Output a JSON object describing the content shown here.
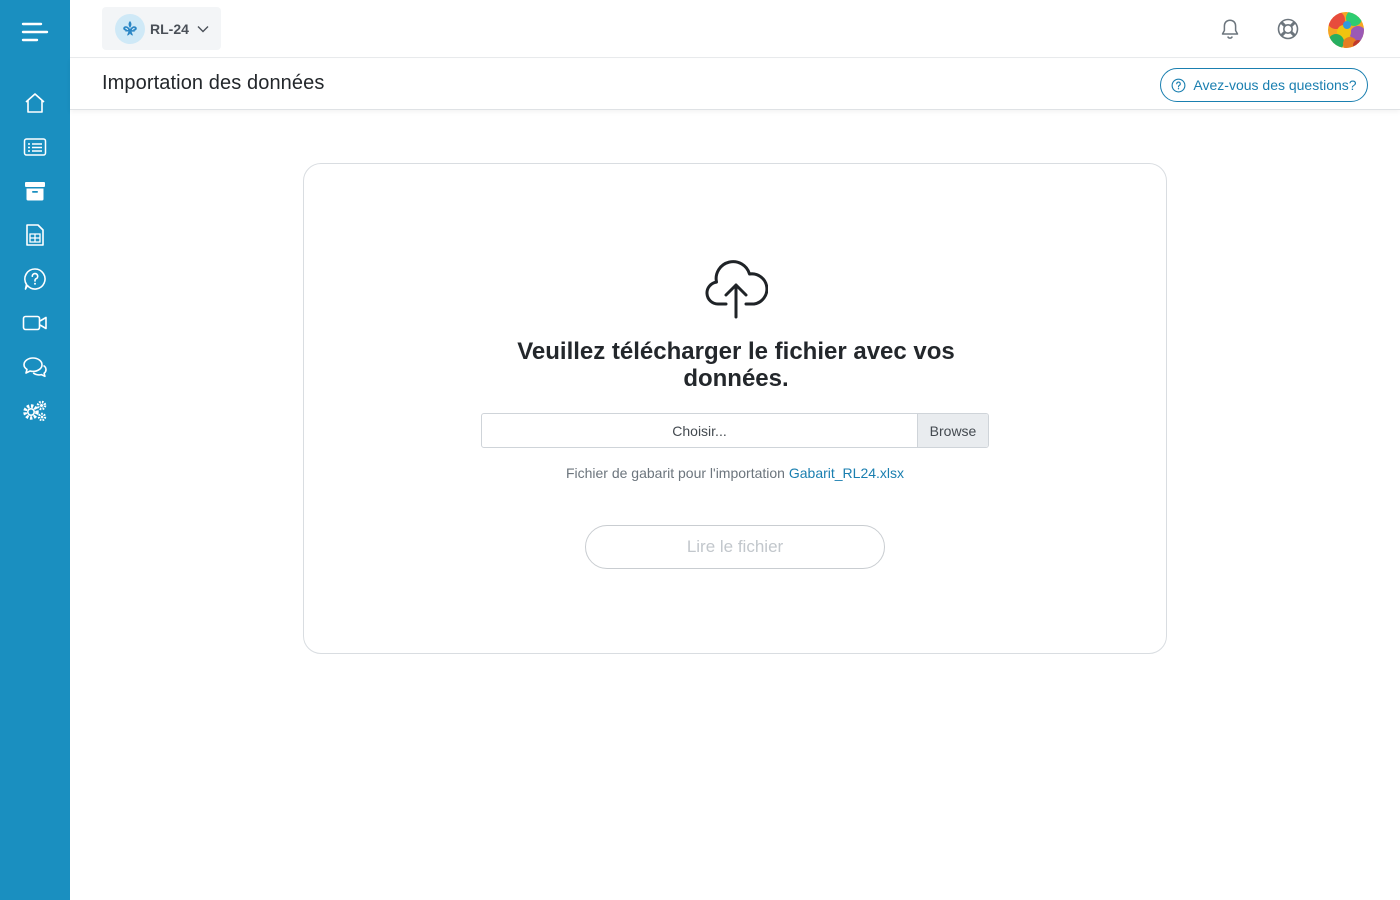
{
  "app": {
    "form_selector": {
      "label": "RL-24"
    }
  },
  "sidebar": {
    "items": [
      {
        "id": "menu",
        "icon": "menu-icon"
      },
      {
        "id": "home",
        "icon": "home-icon"
      },
      {
        "id": "list",
        "icon": "list-icon"
      },
      {
        "id": "archive",
        "icon": "archive-icon"
      },
      {
        "id": "spreadsheet",
        "icon": "spreadsheet-icon"
      },
      {
        "id": "help",
        "icon": "question-circle-icon"
      },
      {
        "id": "video",
        "icon": "video-icon"
      },
      {
        "id": "chat",
        "icon": "chat-icon"
      },
      {
        "id": "settings",
        "icon": "gears-icon"
      }
    ]
  },
  "header": {
    "notifications_icon": "bell-icon",
    "support_icon": "lifebuoy-icon"
  },
  "page": {
    "title": "Importation des données",
    "help_button": "Avez-vous des questions?"
  },
  "upload": {
    "title": "Veuillez télécharger le fichier avec vos données.",
    "file_placeholder": "Choisir...",
    "browse_label": "Browse",
    "template_text": "Fichier de gabarit pour l'importation",
    "template_link": "Gabarit_RL24.xlsx",
    "read_button": "Lire le fichier"
  },
  "colors": {
    "sidebar": "#1a8fc0",
    "accent": "#1a7fb0",
    "disabled_text": "#c2c7cc"
  }
}
